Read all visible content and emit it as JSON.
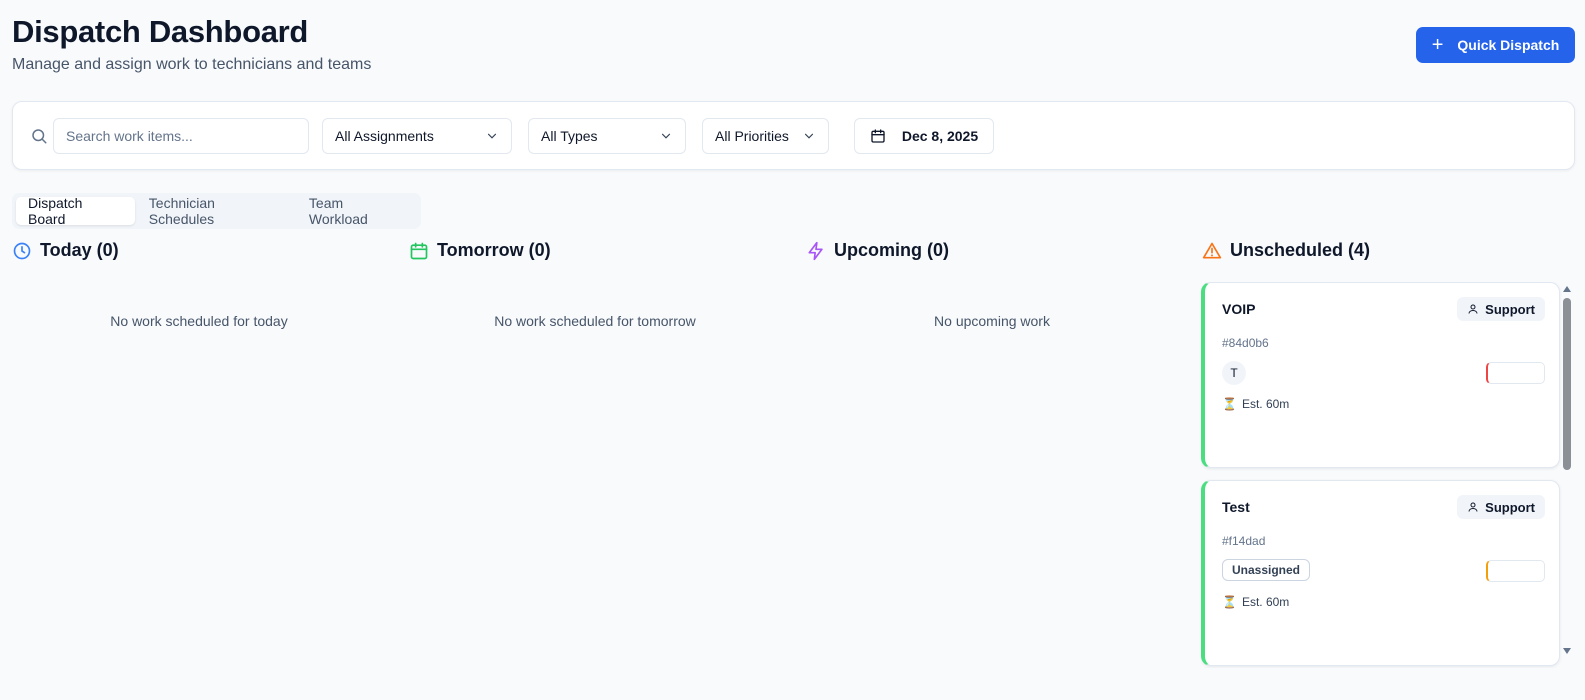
{
  "header": {
    "title": "Dispatch Dashboard",
    "subtitle": "Manage and assign work to technicians and teams",
    "quick_dispatch_label": "Quick Dispatch"
  },
  "filters": {
    "search_placeholder": "Search work items...",
    "assignments": "All Assignments",
    "types": "All Types",
    "priorities": "All Priorities",
    "date": "Dec 8, 2025"
  },
  "tabs": [
    {
      "label": "Dispatch Board",
      "active": true
    },
    {
      "label": "Technician Schedules",
      "active": false
    },
    {
      "label": "Team Workload",
      "active": false
    }
  ],
  "columns": {
    "today": {
      "title": "Today (0)",
      "empty": "No work scheduled for today",
      "icon": "clock-icon",
      "color": "#3b82f6"
    },
    "tomorrow": {
      "title": "Tomorrow (0)",
      "empty": "No work scheduled for tomorrow",
      "icon": "calendar-icon",
      "color": "#22c55e"
    },
    "upcoming": {
      "title": "Upcoming (0)",
      "empty": "No upcoming work",
      "icon": "lightning-icon",
      "color": "#a855f7"
    },
    "unscheduled": {
      "title": "Unscheduled (4)",
      "icon": "warning-icon",
      "color": "#f97316"
    }
  },
  "cards": [
    {
      "title": "VOIP",
      "team": "Support",
      "id": "#84d0b6",
      "assignee_initial": "T",
      "priority_color": "#ef4444",
      "estimate": "Est. 60m"
    },
    {
      "title": "Test",
      "team": "Support",
      "id": "#f14dad",
      "assignee": "Unassigned",
      "priority_color": "#f59e0b",
      "estimate": "Est. 60m"
    }
  ],
  "colors": {
    "accent": "#2563eb",
    "card_border": "#4ade80"
  }
}
